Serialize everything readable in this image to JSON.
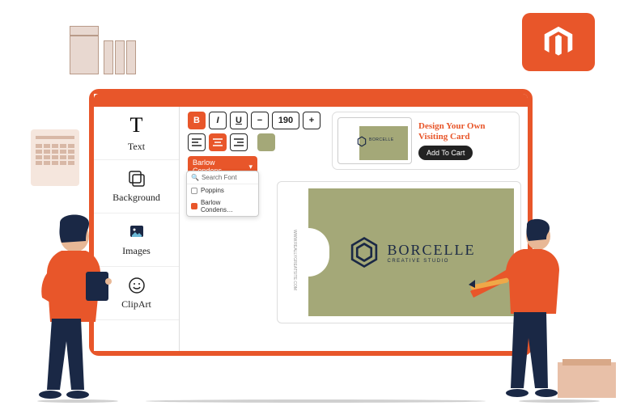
{
  "brand_icon": "magento-icon",
  "sidebar": {
    "items": [
      {
        "label": "Text",
        "icon": "text-icon"
      },
      {
        "label": "Background",
        "icon": "background-icon"
      },
      {
        "label": "Images",
        "icon": "images-icon"
      },
      {
        "label": "ClipArt",
        "icon": "clipart-icon"
      }
    ]
  },
  "toolbar": {
    "bold": "B",
    "italic": "I",
    "underline": "U",
    "minus": "−",
    "size": "190",
    "plus": "+",
    "align_left": "≡",
    "align_center": "≡",
    "align_right": "≡"
  },
  "font_dropdown": {
    "selected": "Barlow Condens…",
    "search_placeholder": "Search Font",
    "options": [
      {
        "label": "Poppins",
        "checked": false
      },
      {
        "label": "Barlow Condens…",
        "checked": true
      }
    ]
  },
  "preview": {
    "title": "Design Your Own Visiting Card",
    "button": "Add To Cart",
    "mini_brand": "BORCELLE"
  },
  "canvas": {
    "side_text": "WWW.REALLYGREATSITE.COM",
    "brand": "BORCELLE",
    "tagline": "CREATIVE STUDIO"
  },
  "colors": {
    "accent": "#e8562a",
    "swatch": "#a4a878",
    "navy": "#1a2845"
  }
}
